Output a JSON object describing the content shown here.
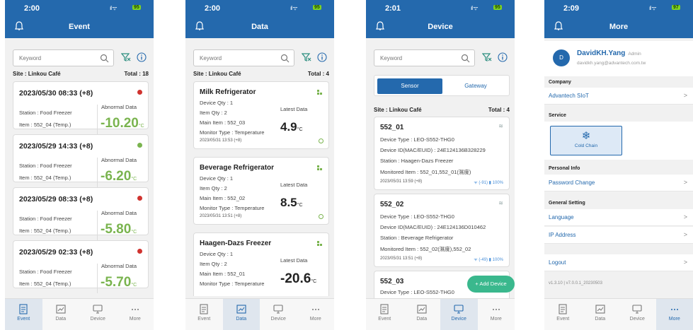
{
  "event": {
    "time": "2:00",
    "signal": "ıl ᯤ",
    "battery": "95",
    "title": "Event",
    "search_placeholder": "Keyword",
    "site": "Site : Linkou Café",
    "total": "Total : 18",
    "cards": [
      {
        "datetime": "2023/05/30 08:33 (+8)",
        "status": "red",
        "station": "Station : Food Freezer",
        "item": "Item : 552_04 (Temp.)",
        "label": "Abnormal Data",
        "value": "-10.20",
        "unit": "°C"
      },
      {
        "datetime": "2023/05/29 14:33 (+8)",
        "status": "green",
        "station": "Station : Food Freezer",
        "item": "Item : 552_04 (Temp.)",
        "label": "Abnormal Data",
        "value": "-6.20",
        "unit": "°C"
      },
      {
        "datetime": "2023/05/29 08:33 (+8)",
        "status": "red",
        "station": "Station : Food Freezer",
        "item": "Item : 552_04 (Temp.)",
        "label": "Abnormal Data",
        "value": "-5.80",
        "unit": "°C"
      },
      {
        "datetime": "2023/05/29 02:33 (+8)",
        "status": "red",
        "station": "Station : Food Freezer",
        "item": "Item : 552_04 (Temp.)",
        "label": "Abnormal Data",
        "value": "-5.70",
        "unit": "°C"
      }
    ]
  },
  "data": {
    "time": "2:00",
    "signal": "ıl ᯤ",
    "battery": "95",
    "title": "Data",
    "search_placeholder": "Keyword",
    "site": "Site : Linkou Café",
    "total": "Total : 4",
    "cards": [
      {
        "name": "Milk Refrigerator",
        "qty": "Device Qty : 1",
        "item_qty": "Item Qty : 2",
        "main": "Main Item : 552_03",
        "monitor": "Monitor Type : Temperature",
        "latest_label": "Latest Data",
        "value": "4.9",
        "unit": "°C",
        "timestamp": "2023/05/31 13:53 (+8)"
      },
      {
        "name": "Beverage Refrigerator",
        "qty": "Device Qty : 1",
        "item_qty": "Item Qty : 2",
        "main": "Main Item : 552_02",
        "monitor": "Monitor Type : Temperature",
        "latest_label": "Latest Data",
        "value": "8.5",
        "unit": "°C",
        "timestamp": "2023/05/31 13:51 (+8)"
      },
      {
        "name": "Haagen-Dazs Freezer",
        "qty": "Device Qty : 1",
        "item_qty": "Item Qty : 2",
        "main": "Main Item : 552_01",
        "monitor": "Monitor Type : Temperature",
        "latest_label": "Latest Data",
        "value": "-20.6",
        "unit": "°C"
      }
    ]
  },
  "device": {
    "time": "2:01",
    "signal": "ıl ᯤ",
    "battery": "95",
    "title": "Device",
    "search_placeholder": "Keyword",
    "seg_sensor": "Sensor",
    "seg_gateway": "Gateway",
    "site": "Site : Linkou Café",
    "total": "Total : 4",
    "cards": [
      {
        "name": "552_01",
        "type": "Device Type : LEO-S552-THG0",
        "id": "Device ID(MAC/EUID) : 24E124136B328229",
        "station": "Station : Haagen-Dazs Freezer",
        "monitored": "Monitored Item : 552_01,552_01(濕度)",
        "timestamp": "2023/05/31 13:59 (+8)",
        "signal": "ᯤ (-91) ▮ 100%"
      },
      {
        "name": "552_02",
        "type": "Device Type : LEO-S552-THG0",
        "id": "Device ID(MAC/EUID) : 24E124136D010462",
        "station": "Station : Beverage Refrigerator",
        "monitored": "Monitored Item : 552_02(濕度),552_02",
        "timestamp": "2023/05/31 13:51 (+8)",
        "signal": "ᯤ (-49) ▮ 100%"
      },
      {
        "name": "552_03",
        "type": "Device Type : LEO-S552-THG0"
      }
    ],
    "fab_label": "+ Add Device"
  },
  "more": {
    "time": "2:09",
    "signal": "ıl ᯤ",
    "battery": "97",
    "title": "More",
    "avatar": "D",
    "user_name": "DavidKH.Yang",
    "role": "Admin",
    "email": "davidkh.yang@advantech.com.tw",
    "company_header": "Company",
    "company": "Advantech SIoT",
    "service_header": "Service",
    "service": "Cold Chain",
    "service_icon": "❄",
    "personal_header": "Personal Info",
    "password": "Password Change",
    "general_header": "General Setting",
    "language": "Language",
    "ip": "IP Address",
    "logout": "Logout",
    "version": "v1.3.10 | v7.0.0.1_20230503"
  },
  "tabs": [
    "Event",
    "Data",
    "Device",
    "More"
  ],
  "colors": {
    "header": "#2469ad",
    "accent_green": "#7ab44f",
    "alert_red": "#d0332f",
    "fab": "#3ab88d"
  }
}
